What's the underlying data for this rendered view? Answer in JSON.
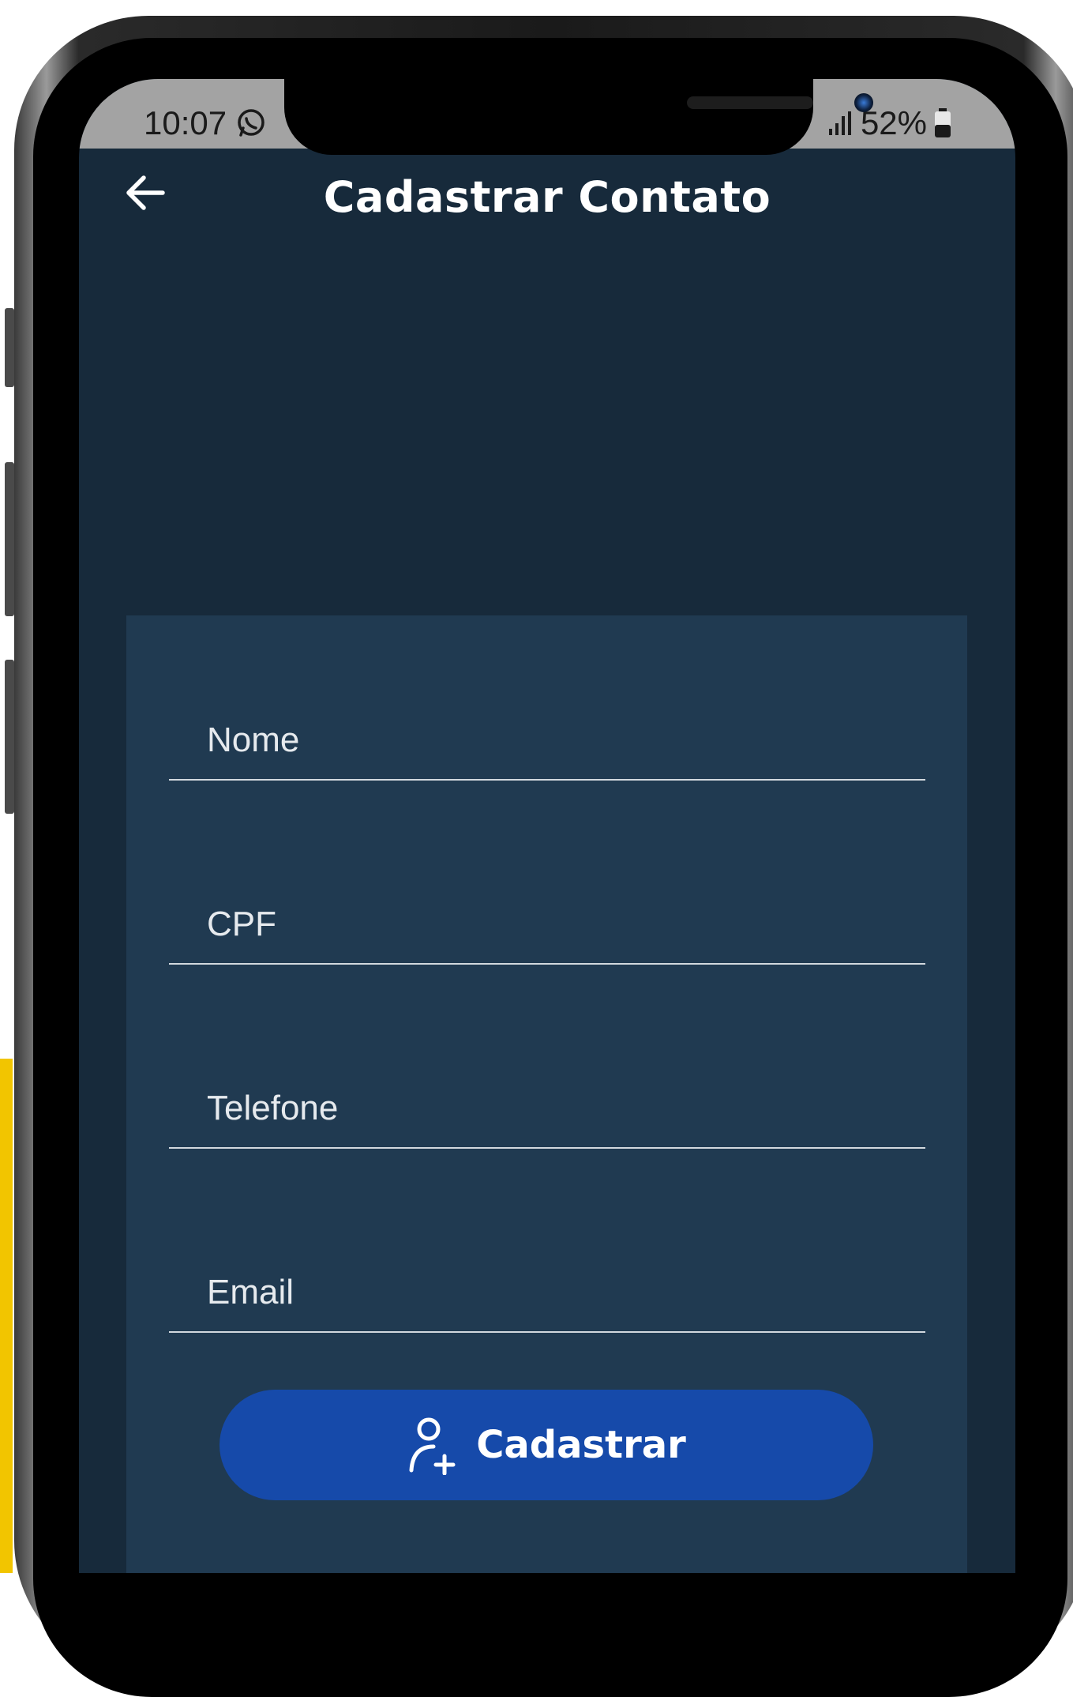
{
  "status_bar": {
    "time": "10:07",
    "battery": "52%",
    "icons": [
      "whatsapp-icon",
      "signal-icon",
      "battery-icon"
    ]
  },
  "app_bar": {
    "title": "Cadastrar Contato",
    "back_icon": "arrow-left-icon"
  },
  "form": {
    "fields": [
      {
        "label": "Nome",
        "value": ""
      },
      {
        "label": "CPF",
        "value": ""
      },
      {
        "label": "Telefone",
        "value": ""
      },
      {
        "label": "Email",
        "value": ""
      }
    ],
    "submit": {
      "label": "Cadastrar",
      "icon": "person-add-icon"
    }
  },
  "colors": {
    "screen_background": "#172a3b",
    "card_background": "#203a51",
    "button_background": "#164aaa",
    "status_bar": "#a3a3a3",
    "text_primary": "#ffffff"
  }
}
